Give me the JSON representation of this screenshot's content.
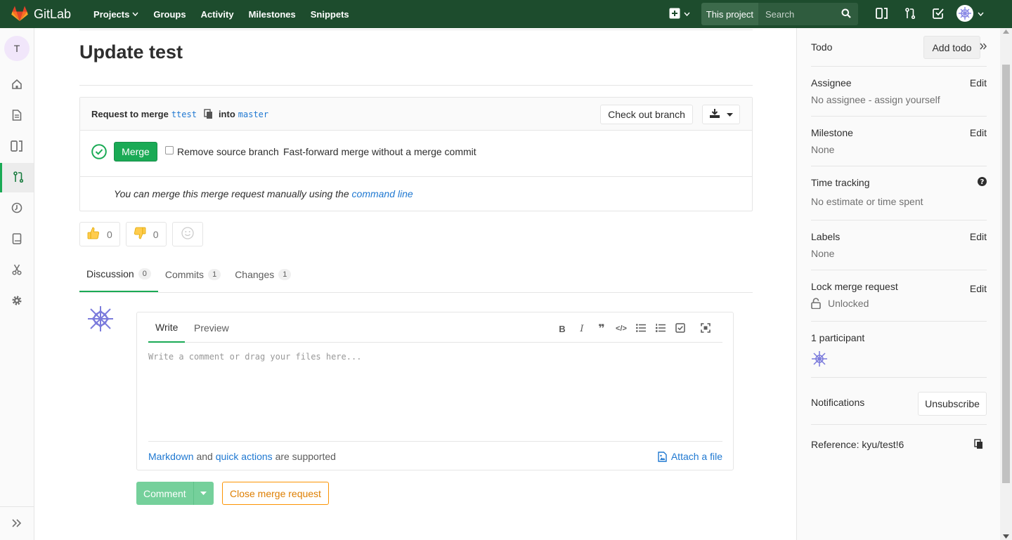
{
  "navbar": {
    "brand": "GitLab",
    "links": [
      {
        "label": "Projects",
        "has_caret": true
      },
      {
        "label": "Groups"
      },
      {
        "label": "Activity"
      },
      {
        "label": "Milestones"
      },
      {
        "label": "Snippets"
      }
    ],
    "search_scope": "This project",
    "search_placeholder": "Search"
  },
  "sidebar": {
    "project_initial": "T",
    "items": [
      "home-icon",
      "doc-icon",
      "board-icon",
      "merge-request-icon",
      "ci-icon",
      "wiki-icon",
      "snippets-icon",
      "settings-icon"
    ],
    "active_item": "merge-request-icon"
  },
  "mr": {
    "title": "Update test",
    "request_prefix": "Request to merge",
    "source_branch": "ttest",
    "into_text": "into",
    "target_branch": "master",
    "checkout_label": "Check out branch",
    "merge_label": "Merge",
    "remove_source_label": "Remove source branch",
    "ff_label": "Fast-forward merge without a merge commit",
    "manual_text": "You can merge this merge request manually using the",
    "command_line_link": "command line"
  },
  "awards": {
    "thumbsup_count": "0",
    "thumbsdown_count": "0"
  },
  "tabs": [
    {
      "label": "Discussion",
      "count": "0"
    },
    {
      "label": "Commits",
      "count": "1"
    },
    {
      "label": "Changes",
      "count": "1"
    }
  ],
  "editor": {
    "write_tab": "Write",
    "preview_tab": "Preview",
    "placeholder": "Write a comment or drag your files here...",
    "markdown_link": "Markdown",
    "and_text": "and",
    "quick_actions_link": "quick actions",
    "supported_text": "are supported",
    "attach_label": "Attach a file"
  },
  "actions": {
    "comment_label": "Comment",
    "close_label": "Close merge request"
  },
  "right_sidebar": {
    "todo_label": "Todo",
    "add_todo_label": "Add todo",
    "assignee_label": "Assignee",
    "assignee_value": "No assignee - assign yourself",
    "milestone_label": "Milestone",
    "milestone_value": "None",
    "time_tracking_label": "Time tracking",
    "time_tracking_value": "No estimate or time spent",
    "labels_label": "Labels",
    "labels_value": "None",
    "lock_label": "Lock merge request",
    "lock_value": "Unlocked",
    "participants_label": "1 participant",
    "notifications_label": "Notifications",
    "unsubscribe_label": "Unsubscribe",
    "reference_label": "Reference: kyu/test!6",
    "edit_label": "Edit"
  },
  "colors": {
    "navbar": "#1d4c2d",
    "accent_green": "#1aaa55",
    "link_blue": "#1f78d1",
    "close_orange": "#fc9403"
  }
}
